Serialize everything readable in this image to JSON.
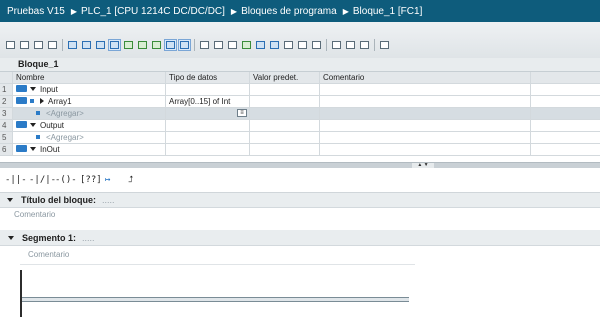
{
  "breadcrumb": {
    "project": "Pruebas V15",
    "device": "PLC_1 [CPU 1214C DC/DC/DC]",
    "folder": "Bloques de programa",
    "block": "Bloque_1 [FC1]"
  },
  "toolbar": {
    "icons": [
      "insert-row-icon",
      "add-row-icon",
      "delete-row-icon",
      "toggle-icon",
      "network-icon",
      "open-all-icon",
      "close-all-icon",
      "view-icon",
      "monitor-icon",
      "compare-icon",
      "absolute-icon",
      "symbol-icon",
      "info-icon",
      "favorites-icon",
      "goto-icon",
      "next-error-icon",
      "previous-error-icon",
      "indent-icon",
      "outdent-icon",
      "comment-icon",
      "uncomment-icon",
      "monitoring-on-icon",
      "monitoring-off-icon",
      "download-icon",
      "settings-icon",
      "extra-icon"
    ]
  },
  "interface": {
    "block_name": "Bloque_1",
    "headers": {
      "name": "Nombre",
      "type": "Tipo de datos",
      "default": "Valor predet.",
      "comment": "Comentario"
    },
    "rows": [
      {
        "num": "1",
        "name": "Input",
        "type": "",
        "kind": "section"
      },
      {
        "num": "2",
        "name": "Array1",
        "type": "Array[0..15] of Int",
        "kind": "var"
      },
      {
        "num": "3",
        "name": "<Agregar>",
        "type": "",
        "kind": "add"
      },
      {
        "num": "4",
        "name": "Output",
        "type": "",
        "kind": "section"
      },
      {
        "num": "5",
        "name": "<Agregar>",
        "type": "",
        "kind": "add"
      },
      {
        "num": "6",
        "name": "InOut",
        "type": "",
        "kind": "section"
      }
    ]
  },
  "lad_toolbar": {
    "items": [
      {
        "name": "no-contact-icon",
        "glyph": "-||-"
      },
      {
        "name": "nc-contact-icon",
        "glyph": "-|/|-"
      },
      {
        "name": "coil-icon",
        "glyph": "-()-"
      },
      {
        "name": "empty-box-icon",
        "glyph": "[??]"
      },
      {
        "name": "open-branch-icon",
        "glyph": "↦"
      },
      {
        "name": "close-branch-icon",
        "glyph": "⮥"
      }
    ]
  },
  "block_title": {
    "label": "Título del bloque:",
    "dots": ".....",
    "comment": "Comentario"
  },
  "segment": {
    "label": "Segmento 1:",
    "dots": ".....",
    "comment": "Comentario"
  }
}
